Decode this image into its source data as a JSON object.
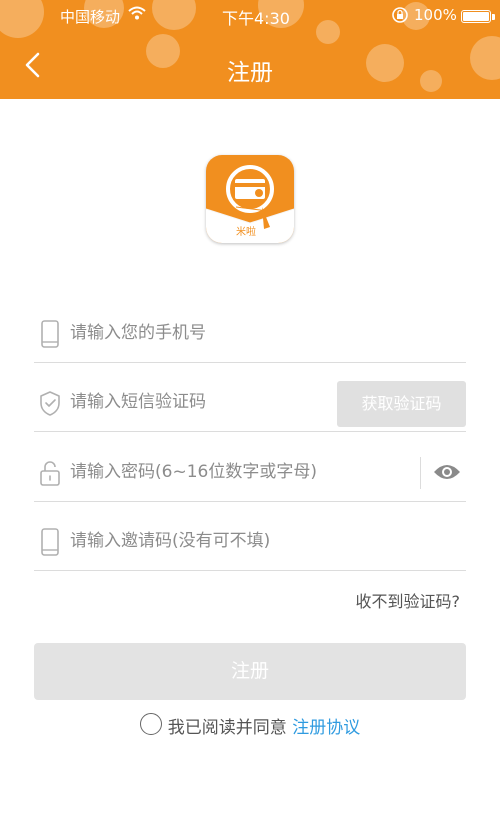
{
  "status_bar": {
    "carrier": "中国移动",
    "time": "下午4:30",
    "battery": "100%"
  },
  "header": {
    "title": "注册",
    "back_icon": "chevron-left-icon"
  },
  "logo": {
    "text": "米啦"
  },
  "form": {
    "phone_placeholder": "请输入您的手机号",
    "code_placeholder": "请输入短信验证码",
    "get_code_label": "获取验证码",
    "password_placeholder": "请输入密码(6~16位数字或字母)",
    "invite_placeholder": "请输入邀请码(没有可不填)"
  },
  "no_code_link": "收不到验证码?",
  "submit_label": "注册",
  "agreement": {
    "text": "我已阅读并同意",
    "link": "注册协议"
  },
  "colors": {
    "brand": "#f18f1f",
    "link": "#2f9be0",
    "disabled_button": "#e3e3e3"
  }
}
